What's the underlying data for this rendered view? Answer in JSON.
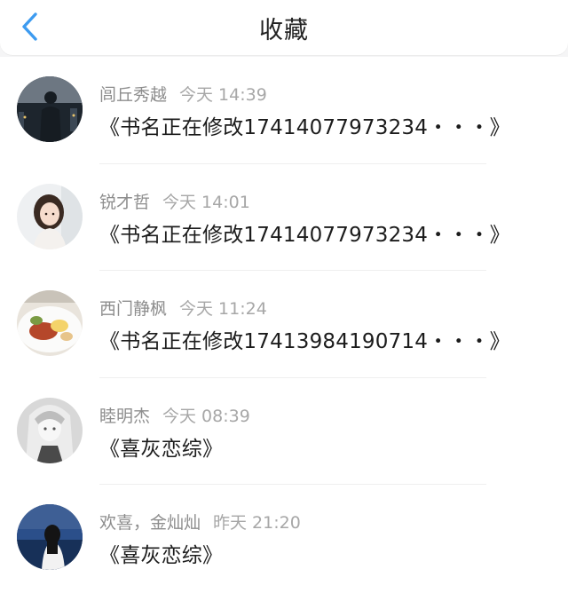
{
  "header": {
    "title": "收藏",
    "back_icon": "chevron-left-icon",
    "accent_color": "#3d9bf0"
  },
  "favorites": [
    {
      "name": "闾丘秀越",
      "time": "今天 14:39",
      "text": "《书名正在修改17414077973234・・・》",
      "avatar": "night-city-silhouette"
    },
    {
      "name": "锐才哲",
      "time": "今天 14:01",
      "text": "《书名正在修改17414077973234・・・》",
      "avatar": "girl-portrait"
    },
    {
      "name": "西门静枫",
      "time": "今天 11:24",
      "text": "《书名正在修改17413984190714・・・》",
      "avatar": "food-plate"
    },
    {
      "name": "睦明杰",
      "time": "今天 08:39",
      "text": "《喜灰恋综》",
      "avatar": "anime-girl-grayscale"
    },
    {
      "name": "欢喜，金灿灿",
      "time": "昨天 21:20",
      "text": "《喜灰恋综》",
      "avatar": "girl-by-sea"
    }
  ]
}
